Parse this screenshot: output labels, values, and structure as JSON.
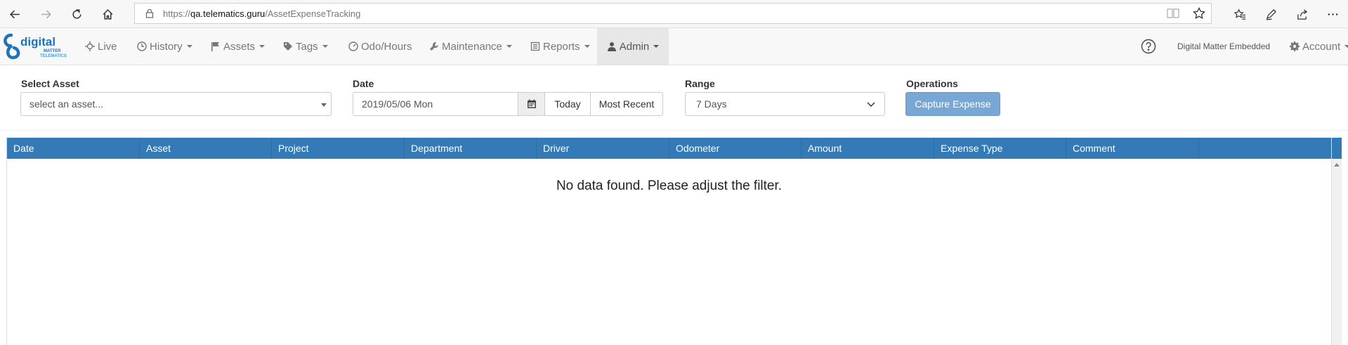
{
  "browser": {
    "url_prefix": "https://",
    "url_host": "qa.telematics.guru",
    "url_path": "/AssetExpenseTracking",
    "icons": [
      "back-arrow-icon",
      "forward-arrow-icon",
      "refresh-icon",
      "home-icon",
      "lock-icon",
      "reading-view-icon",
      "favorite-star-icon",
      "favorites-hub-icon",
      "pen-icon",
      "share-icon",
      "more-icon"
    ]
  },
  "navbar": {
    "logo_text": "digital",
    "logo_sub1": "MATTER",
    "logo_sub2": "TELEMATICS",
    "items": [
      {
        "label": "Live",
        "icon": "crosshair-icon",
        "dropdown": false
      },
      {
        "label": "History",
        "icon": "clock-icon",
        "dropdown": true
      },
      {
        "label": "Assets",
        "icon": "flag-icon",
        "dropdown": true
      },
      {
        "label": "Tags",
        "icon": "tag-icon",
        "dropdown": true
      },
      {
        "label": "Odo/Hours",
        "icon": "gauge-icon",
        "dropdown": false
      },
      {
        "label": "Maintenance",
        "icon": "wrench-icon",
        "dropdown": true
      },
      {
        "label": "Reports",
        "icon": "list-icon",
        "dropdown": true
      },
      {
        "label": "Admin",
        "icon": "user-icon",
        "dropdown": true,
        "active": true
      }
    ],
    "help_icon": "help-circle-icon",
    "org_name": "Digital Matter Embedded",
    "account_label": "Account",
    "account_icon": "gear-icon"
  },
  "filters": {
    "asset_label": "Select Asset",
    "asset_value": "select an asset...",
    "date_label": "Date",
    "date_value": "2019/05/06 Mon",
    "today_label": "Today",
    "most_recent_label": "Most Recent",
    "range_label": "Range",
    "range_value": "7 Days",
    "operations_label": "Operations",
    "capture_label": "Capture Expense"
  },
  "table": {
    "columns": [
      "Date",
      "Asset",
      "Project",
      "Department",
      "Driver",
      "Odometer",
      "Amount",
      "Expense Type",
      "Comment",
      ""
    ],
    "empty_message": "No data found. Please adjust the filter."
  },
  "colors": {
    "header_blue": "#337ab7",
    "capture_button": "#78a7d6",
    "logo_blue": "#1e73be"
  }
}
